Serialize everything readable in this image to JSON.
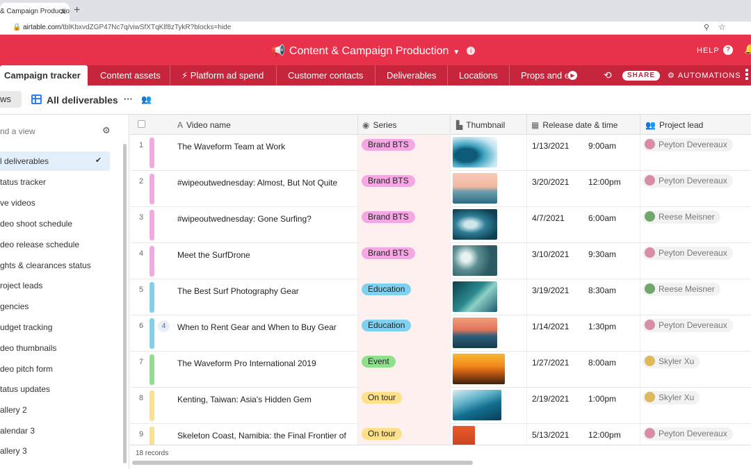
{
  "browser": {
    "tab_title": "& Campaign Productio",
    "close_glyph": "✕",
    "new_tab_glyph": "+",
    "url_host": "airtable.com",
    "url_path": "/tblKbxvdZGP47Nc7q/viwSfXTqKlf8zTykR?blocks=hide"
  },
  "header": {
    "base_title": "Content & Campaign Production",
    "help_label": "HELP"
  },
  "table_tabs": [
    {
      "label": "Campaign tracker"
    },
    {
      "label": "Content assets"
    },
    {
      "label": "Platform ad spend"
    },
    {
      "label": "Customer contacts"
    },
    {
      "label": "Deliverables"
    },
    {
      "label": "Locations"
    },
    {
      "label": "Props and e"
    }
  ],
  "toolbar": {
    "share_label": "SHARE",
    "automations_label": "AUTOMATIONS"
  },
  "viewbar": {
    "views_label": "ws",
    "view_name": "All deliverables",
    "more_glyph": "···"
  },
  "sidebar": {
    "find_placeholder": "nd a view",
    "items": [
      {
        "label": "l deliverables"
      },
      {
        "label": "tatus tracker"
      },
      {
        "label": "ve videos"
      },
      {
        "label": "deo shoot schedule"
      },
      {
        "label": "deo release schedule"
      },
      {
        "label": "ghts & clearances status"
      },
      {
        "label": "roject leads"
      },
      {
        "label": "gencies"
      },
      {
        "label": "udget tracking"
      },
      {
        "label": "deo thumbnails"
      },
      {
        "label": "deo pitch form"
      },
      {
        "label": "tatus updates"
      },
      {
        "label": "allery 2"
      },
      {
        "label": "alendar 3"
      },
      {
        "label": "allery 3"
      }
    ]
  },
  "columns": {
    "video_name": "Video name",
    "series": "Series",
    "thumbnail": "Thumbnail",
    "release": "Release date & time",
    "lead": "Project lead"
  },
  "rows": [
    {
      "num": "1",
      "name": "The Waveform Team at Work",
      "series": "Brand BTS",
      "date": "1/13/2021",
      "time": "9:00am",
      "lead": "Peyton Devereaux"
    },
    {
      "num": "2",
      "name": "#wipeoutwednesday: Almost, But Not Quite",
      "series": "Brand BTS",
      "date": "3/20/2021",
      "time": "12:00pm",
      "lead": "Peyton Devereaux"
    },
    {
      "num": "3",
      "name": "#wipeoutwednesday: Gone Surfing?",
      "series": "Brand BTS",
      "date": "4/7/2021",
      "time": "6:00am",
      "lead": "Reese Meisner"
    },
    {
      "num": "4",
      "name": "Meet the SurfDrone",
      "series": "Brand BTS",
      "date": "3/10/2021",
      "time": "9:30am",
      "lead": "Peyton Devereaux"
    },
    {
      "num": "5",
      "name": "The Best Surf Photography Gear",
      "series": "Education",
      "date": "3/19/2021",
      "time": "8:30am",
      "lead": "Reese Meisner"
    },
    {
      "num": "6",
      "count": "4",
      "name": "When to Rent Gear and When to Buy Gear",
      "series": "Education",
      "date": "1/14/2021",
      "time": "1:30pm",
      "lead": "Peyton Devereaux"
    },
    {
      "num": "7",
      "name": "The Waveform Pro International 2019",
      "series": "Event",
      "date": "1/27/2021",
      "time": "8:00am",
      "lead": "Skyler Xu"
    },
    {
      "num": "8",
      "name": "Kenting, Taiwan: Asia's Hidden Gem",
      "series": "On tour",
      "date": "2/19/2021",
      "time": "1:00pm",
      "lead": "Skyler Xu"
    },
    {
      "num": "9",
      "name": "Skeleton Coast, Namibia: the Final Frontier of",
      "series": "On tour",
      "date": "5/13/2021",
      "time": "12:00pm",
      "lead": "Peyton Devereaux"
    }
  ],
  "footer": {
    "records": "18 records"
  },
  "colors": {
    "header_red": "#e8314a",
    "tabbar_red": "#c7253b",
    "brand_bts": "#f4a7e3",
    "education": "#7fd1f0",
    "event": "#8fe08a",
    "on_tour": "#fde08a"
  }
}
